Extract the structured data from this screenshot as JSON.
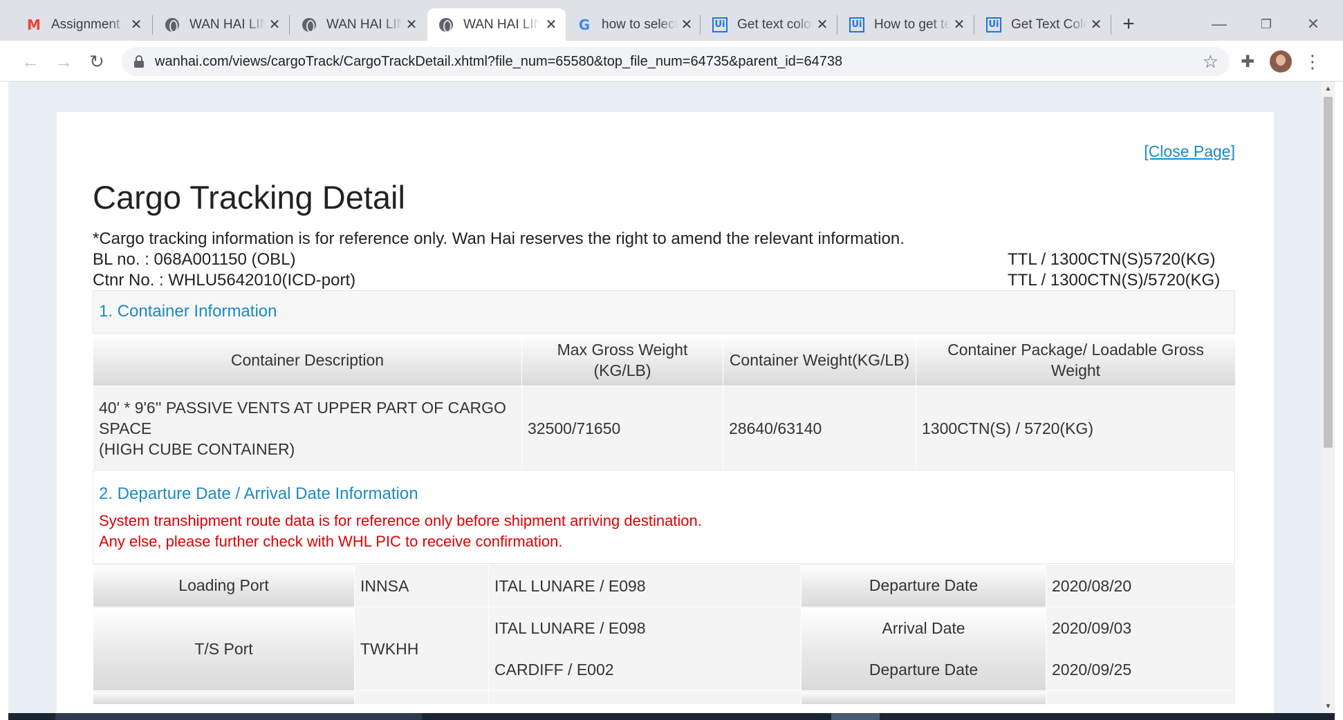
{
  "browser": {
    "tabs": [
      {
        "title": "Assignment",
        "icon": "gmail-icon",
        "active": false
      },
      {
        "title": "WAN HAI LINES",
        "icon": "globe-icon",
        "active": false
      },
      {
        "title": "WAN HAI LINES",
        "icon": "globe-icon",
        "active": false
      },
      {
        "title": "WAN HAI LINES",
        "icon": "globe-icon",
        "active": true
      },
      {
        "title": "how to select",
        "icon": "google-icon",
        "active": false
      },
      {
        "title": "Get text color",
        "icon": "uipath-icon",
        "active": false
      },
      {
        "title": "How to get text",
        "icon": "uipath-icon",
        "active": false
      },
      {
        "title": "Get Text Color",
        "icon": "uipath-icon",
        "active": false
      }
    ],
    "url": "wanhai.com/views/cargoTrack/CargoTrackDetail.xhtml?file_num=65580&top_file_num=64735&parent_id=64738"
  },
  "page": {
    "close_link": "[Close Page]",
    "title": "Cargo Tracking Detail",
    "notice": "*Cargo tracking information is for reference only. Wan Hai reserves the right to amend the relevant information.",
    "bl_no": "BL no. : 068A001150 (OBL)",
    "ctnr_no": "Ctnr No. : WHLU5642010(ICD-port)",
    "ttl_1": "TTL / 1300CTN(S)5720(KG)",
    "ttl_2": "TTL / 1300CTN(S)/5720(KG)"
  },
  "container_info": {
    "section_title": "1. Container Information",
    "headers": {
      "description": "Container Description",
      "max_gross": "Max Gross Weight (KG/LB)",
      "container_weight": "Container Weight(KG/LB)",
      "package": "Container Package/ Loadable Gross Weight"
    },
    "row": {
      "description_line1": "40' * 9'6'' PASSIVE VENTS AT UPPER PART OF CARGO SPACE",
      "description_line2": "(HIGH CUBE CONTAINER)",
      "max_gross": "32500/71650",
      "container_weight": "28640/63140",
      "package": "1300CTN(S) / 5720(KG)"
    }
  },
  "departure_info": {
    "section_title": "2. Departure Date / Arrival Date Information",
    "warning_line1": "System transhipment route data is for reference only before shipment arriving destination.",
    "warning_line2": "Any else, please further check with WHL PIC to receive confirmation.",
    "loading": {
      "label": "Loading Port",
      "port": "INNSA",
      "vessel": "ITAL LUNARE / E098",
      "date_label": "Departure Date",
      "date": "2020/08/20"
    },
    "ts": {
      "label": "T/S Port",
      "port": "TWKHH",
      "vessel_in": "ITAL LUNARE / E098",
      "vessel_out": "CARDIFF / E002",
      "arrival_label": "Arrival Date",
      "arrival_date": "2020/09/03",
      "departure_label": "Departure Date",
      "departure_date": "2020/09/25"
    }
  }
}
